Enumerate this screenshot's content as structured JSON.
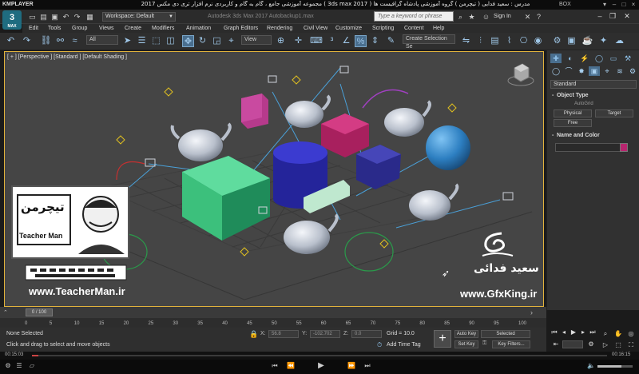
{
  "player": {
    "brand": "KMPLAYER",
    "title": "مجموعه آموزشی جامع ، گام به گام و کاربردی نرم افزار تری دی مکس 2017  ( 3ds max 2017 )  مدرس : سعید فدایی ( تیچرمن ) گروه آموزشی پادشاه گرافیست ها",
    "box_label": "BOX",
    "time_current": "00:15:03",
    "time_total": "00:16:15"
  },
  "app": {
    "logo_text": "3",
    "logo_sub": "MAX",
    "workspace": "Workspace: Default",
    "doc_title": "Autodesk 3ds Max 2017   Autobackup1.max",
    "search_placeholder": "Type a keyword or phrase",
    "signin": "Sign In"
  },
  "menu": [
    "Edit",
    "Tools",
    "Group",
    "Views",
    "Create",
    "Modifiers",
    "Animation",
    "Graph Editors",
    "Rendering",
    "Civil View",
    "Customize",
    "Scripting",
    "Content",
    "Help"
  ],
  "toolbar": {
    "filter": "All",
    "coord_system": "View",
    "selection_set": "Create Selection Se"
  },
  "viewport": {
    "label": "[ + ] [Perspective ] [Standard ] [Default Shading ]"
  },
  "overlays": {
    "teacher_url": "www.TeacherMan.ir",
    "teacher_name": "Teacher Man",
    "teacher_logo_fa": "تیچرمن",
    "gfx_name": "سعید فدائی",
    "gfx_url": "www.GfxKing.ir"
  },
  "command_panel": {
    "category": "Standard",
    "object_type_title": "Object Type",
    "autogrid": "AutoGrid",
    "buttons": [
      "Physical",
      "Target",
      "Free"
    ],
    "name_color_title": "Name and Color",
    "color": "#b8266f"
  },
  "timeline": {
    "thumb": "0 / 100",
    "ticks": [
      "0",
      "5",
      "10",
      "15",
      "20",
      "25",
      "30",
      "35",
      "40",
      "45",
      "50",
      "55",
      "60",
      "65",
      "70",
      "75",
      "80",
      "85",
      "90",
      "95",
      "100"
    ]
  },
  "status": {
    "selection": "None Selected",
    "prompt": "Click and drag to select and move objects",
    "x_label": "X:",
    "x_value": "56.8",
    "y_label": "Y:",
    "y_value": "-102.702",
    "z_label": "Z:",
    "z_value": "0.0",
    "grid": "Grid = 10.0",
    "add_time_tag": "Add Time Tag",
    "auto_key": "Auto Key",
    "selected": "Selected",
    "set_key": "Set Key",
    "key_filters": "Key Filters..."
  }
}
